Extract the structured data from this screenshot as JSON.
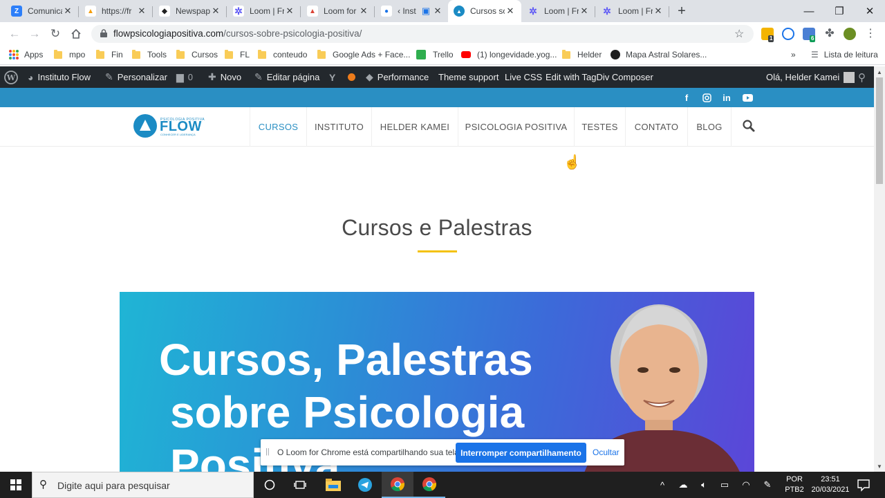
{
  "browser": {
    "tabs": [
      {
        "title": "Comunicação",
        "favicon_color": "#2d7ff9",
        "favicon_glyph": "Z"
      },
      {
        "title": "https://fr",
        "favicon_color": "#f59e0b",
        "favicon_glyph": "▲"
      },
      {
        "title": "Newspaper",
        "favicon_color": "#222222",
        "favicon_glyph": "◆"
      },
      {
        "title": "Loom | Fr",
        "favicon_color": "#625df5",
        "favicon_glyph": "✲"
      },
      {
        "title": "Loom for",
        "favicon_color": "#db4437",
        "favicon_glyph": "▲"
      },
      {
        "title": "‹ Inst",
        "favicon_color": "#1a73e8",
        "favicon_glyph": "●"
      },
      {
        "title": "Cursos sobre",
        "favicon_color": "#1b8bc4",
        "favicon_glyph": "▲"
      },
      {
        "title": "Loom | Fr",
        "favicon_color": "#625df5",
        "favicon_glyph": "✲"
      },
      {
        "title": "Loom | Fr",
        "favicon_color": "#625df5",
        "favicon_glyph": "✲"
      }
    ],
    "active_tab_index": 6,
    "new_tab_symbol": "+",
    "window_controls": {
      "minimize": "—",
      "maximize": "❐",
      "close": "✕"
    },
    "url_domain": "flowpsicologiapositiva.com",
    "url_path": "/cursos-sobre-psicologia-positiva/",
    "extension_badges": [
      "1",
      "6"
    ]
  },
  "bookmarks": {
    "items": [
      "Apps",
      "mpo",
      "Fin",
      "Tools",
      "Cursos",
      "FL",
      "conteudo",
      "Google Ads + Face...",
      "Trello",
      "(1) longevidade.yog...",
      "Helder",
      "Mapa Astral Solares..."
    ],
    "overflow": "»",
    "reading_list": "Lista de leitura"
  },
  "wp_admin": {
    "site_name": "Instituto Flow",
    "customize": "Personalizar",
    "comments_count": "0",
    "new": "Novo",
    "edit_page": "Editar página",
    "performance": "Performance",
    "theme_support": "Theme support",
    "live_css": "Live CSS",
    "tagdiv": "Edit with TagDiv Composer",
    "greeting": "Olá, Helder Kamei"
  },
  "site": {
    "logo_small": "PSICOLOGIA POSITIVA",
    "logo_word": "FLOW",
    "logo_sub": "CONHECER E LIDERANÇA",
    "menu": [
      "CURSOS",
      "INSTITUTO",
      "HELDER KAMEI",
      "PSICOLOGIA POSITIVA",
      "TESTES",
      "CONTATO",
      "BLOG"
    ],
    "page_title": "Cursos e Palestras",
    "banner_line1": "Cursos, Palestras",
    "banner_line2": "sobre Psicologia",
    "banner_line3": "Positiva",
    "accent_color": "#2a8fc3",
    "underline_color": "#f4c20d"
  },
  "loom": {
    "grip": "||",
    "message": "O Loom for Chrome está compartilhando sua tela.",
    "stop_button": "Interromper compartilhamento",
    "hide": "Ocultar"
  },
  "taskbar": {
    "search_placeholder": "Digite aqui para pesquisar",
    "lang_1": "POR",
    "lang_2": "PTB2",
    "time": "23:51",
    "date": "20/03/2021"
  }
}
